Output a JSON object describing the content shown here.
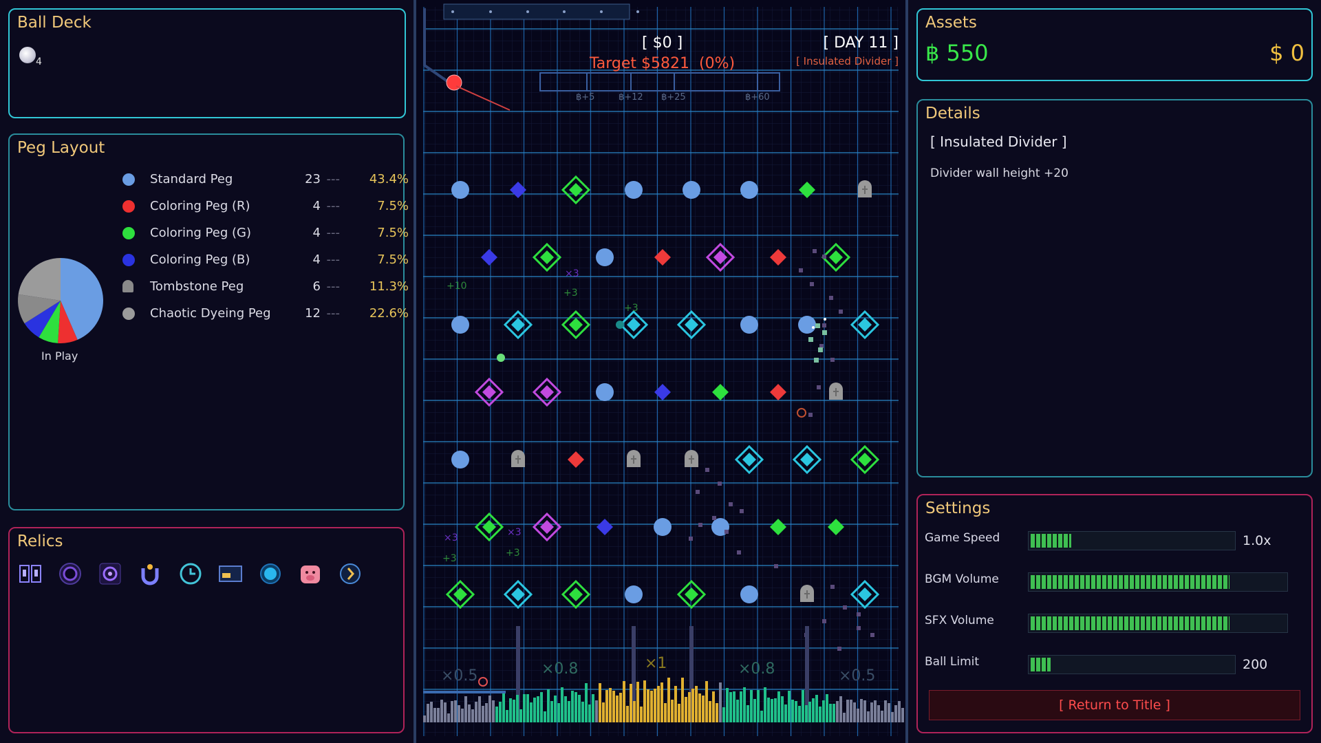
{
  "ball_deck": {
    "title": "Ball Deck",
    "count": "4"
  },
  "peg_layout": {
    "title": "Peg Layout",
    "chart_label": "In Play",
    "dash": "---",
    "items": [
      {
        "label": "Standard Peg",
        "count": "23",
        "pct": "43.4%",
        "color": "#6a9de3",
        "share": 43.4
      },
      {
        "label": "Coloring Peg (R)",
        "count": "4",
        "pct": "7.5%",
        "color": "#ee3030",
        "share": 7.5
      },
      {
        "label": "Coloring Peg (G)",
        "count": "4",
        "pct": "7.5%",
        "color": "#2ee03e",
        "share": 7.5
      },
      {
        "label": "Coloring Peg (B)",
        "count": "4",
        "pct": "7.5%",
        "color": "#2a33e0",
        "share": 7.5
      },
      {
        "label": "Tombstone Peg",
        "count": "6",
        "pct": "11.3%",
        "color": "#8a8a8a",
        "share": 11.3
      },
      {
        "label": "Chaotic Dyeing Peg",
        "count": "12",
        "pct": "22.6%",
        "color": "#9b9b9b",
        "share": 22.6
      }
    ]
  },
  "relics": {
    "title": "Relics",
    "icons": [
      "book-icon",
      "vortex-icon",
      "spiral-icon",
      "magnet-icon",
      "clock-icon",
      "card-icon",
      "orb-icon",
      "pig-icon",
      "compass-icon"
    ]
  },
  "board": {
    "money": "[ $0 ]",
    "day": "[ DAY 11 ]",
    "target": "Target $5821  (0%)",
    "current_item": "[ Insulated Divider ]",
    "milestones": [
      "฿+5",
      "฿+12",
      "฿+25",
      "฿+60"
    ],
    "multipliers": [
      "×0.5",
      "×0.8",
      "×1",
      "×0.8",
      "×0.5"
    ],
    "float_texts": [
      "+10",
      "×3",
      "+3",
      "+3",
      "×3",
      "×3",
      "+3",
      "+3"
    ]
  },
  "assets": {
    "title": "Assets",
    "bits": "฿ 550",
    "dollars": "$ 0"
  },
  "details": {
    "title": "Details",
    "item_name": "[ Insulated Divider ]",
    "description": "Divider wall height +20"
  },
  "settings": {
    "title": "Settings",
    "game_speed": {
      "label": "Game Speed",
      "value": "1.0x",
      "level": 0.2
    },
    "bgm_volume": {
      "label": "BGM Volume",
      "level": 0.78
    },
    "sfx_volume": {
      "label": "SFX Volume",
      "level": 0.78
    },
    "ball_limit": {
      "label": "Ball Limit",
      "value": "200",
      "level": 0.1
    },
    "return_label": "[ Return to Title ]"
  },
  "colors": {
    "accent_cyan": "#31c7d6",
    "accent_pink": "#b02359",
    "gold": "#f0c87a",
    "green": "#39e84a",
    "target_red": "#ff5a3c"
  }
}
